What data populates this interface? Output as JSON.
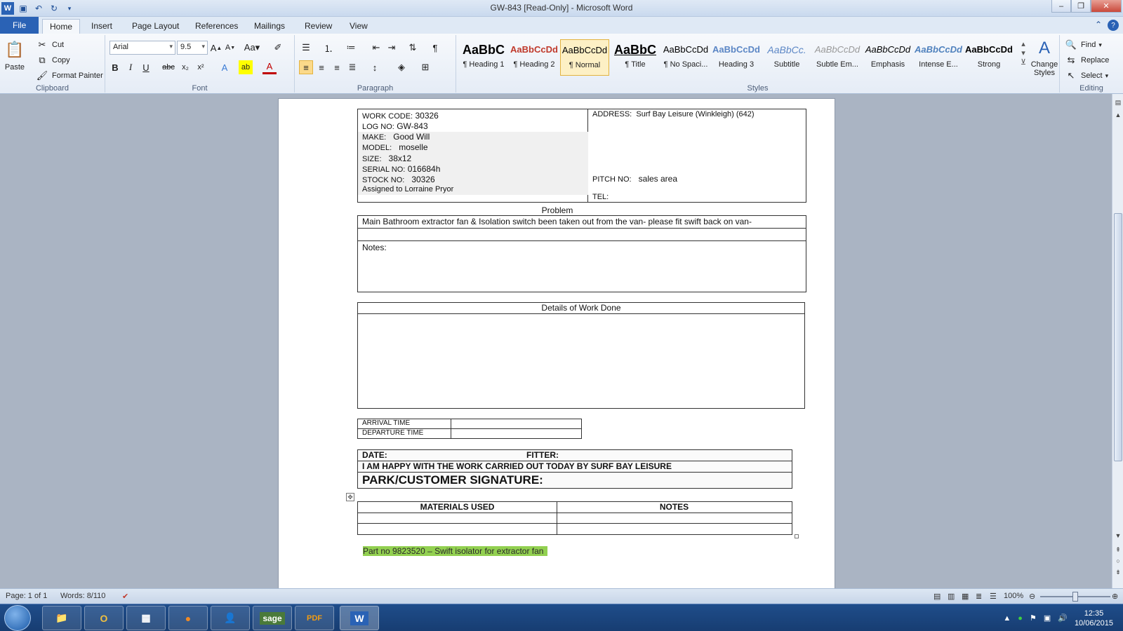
{
  "window": {
    "title": "GW-843 [Read-Only] - Microsoft Word"
  },
  "tabs": [
    "File",
    "Home",
    "Insert",
    "Page Layout",
    "References",
    "Mailings",
    "Review",
    "View"
  ],
  "ribbon": {
    "clipboard": {
      "paste": "Paste",
      "cut": "Cut",
      "copy": "Copy",
      "format_painter": "Format Painter",
      "name": "Clipboard"
    },
    "font": {
      "family": "Arial",
      "size": "9.5",
      "name": "Font"
    },
    "paragraph": {
      "name": "Paragraph"
    },
    "styles": {
      "name": "Styles",
      "items": [
        {
          "sample": "AaBbC",
          "label": "¶ Heading 1"
        },
        {
          "sample": "AaBbCcDd",
          "label": "¶ Heading 2"
        },
        {
          "sample": "AaBbCcDd",
          "label": "¶ Normal"
        },
        {
          "sample": "AaBbC",
          "label": "¶ Title"
        },
        {
          "sample": "AaBbCcDd",
          "label": "¶ No Spaci..."
        },
        {
          "sample": "AaBbCcDd",
          "label": "Heading 3"
        },
        {
          "sample": "AaBbCc.",
          "label": "Subtitle"
        },
        {
          "sample": "AaBbCcDd",
          "label": "Subtle Em..."
        },
        {
          "sample": "AaBbCcDd",
          "label": "Emphasis"
        },
        {
          "sample": "AaBbCcDd",
          "label": "Intense E..."
        },
        {
          "sample": "AaBbCcDd",
          "label": "Strong"
        }
      ],
      "change_styles": "Change Styles"
    },
    "editing": {
      "find": "Find",
      "replace": "Replace",
      "select": "Select",
      "name": "Editing"
    }
  },
  "document": {
    "header_left": {
      "work_code_label": "WORK CODE:",
      "work_code": "30326",
      "log_no_label": "LOG NO:",
      "log_no": "GW-843",
      "make_label": "MAKE:",
      "make": "Good Will",
      "model_label": "MODEL:",
      "model": "moselle",
      "size_label": "SIZE:",
      "size": "38x12",
      "serial_label": "SERIAL NO:",
      "serial": "016684h",
      "stock_label": "STOCK NO:",
      "stock": "30326",
      "assigned": "Assigned to Lorraine Pryor"
    },
    "header_right": {
      "address_label": "ADDRESS:",
      "address": "Surf Bay Leisure (Winkleigh) (642)",
      "pitch_label": "PITCH NO:",
      "pitch": "sales area",
      "tel_label": "TEL:"
    },
    "problem_title": "Problem",
    "problem_text": "Main Bathroom extractor fan & Isolation switch been taken out from the van- please fit swift back on van-",
    "notes_label": "Notes:",
    "work_done_title": "Details of Work Done",
    "arrival_label": "ARRIVAL TIME",
    "departure_label": "DEPARTURE TIME",
    "date_label": "DATE:",
    "fitter_label": "FITTER:",
    "happy_text": "I AM HAPPY WITH THE WORK CARRIED OUT TODAY BY SURF BAY LEISURE",
    "signature_label": "PARK/CUSTOMER SIGNATURE:",
    "materials_header": "MATERIALS USED",
    "notes_header": "NOTES",
    "part_text": "Part no 9823520 – Swift isolator for extractor fan"
  },
  "status": {
    "page": "Page: 1 of 1",
    "words": "Words: 8/110",
    "zoom": "100%"
  },
  "taskbar": {
    "apps": [
      "Explorer",
      "Outlook",
      "Calendar",
      "Firefox",
      "Contacts",
      "sage",
      "PDF",
      "Word"
    ],
    "time": "12:35",
    "date": "10/06/2015"
  }
}
